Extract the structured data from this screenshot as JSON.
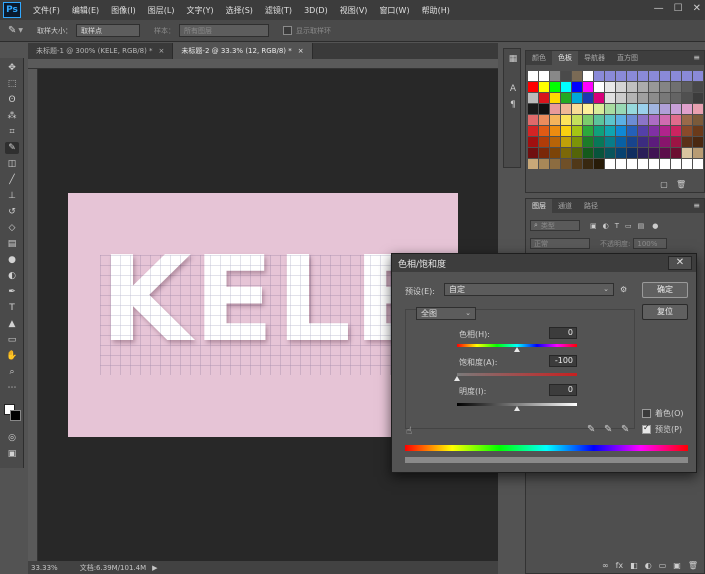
{
  "app": {
    "logo": "Ps"
  },
  "menu": [
    "文件(F)",
    "编辑(E)",
    "图像(I)",
    "图层(L)",
    "文字(Y)",
    "选择(S)",
    "滤镜(T)",
    "3D(D)",
    "视图(V)",
    "窗口(W)",
    "帮助(H)"
  ],
  "window_controls": {
    "minimize": "—",
    "maximize": "☐",
    "close": "✕"
  },
  "options_bar": {
    "sample_size_label": "取样大小：",
    "sample_size_value": "取样点",
    "sample_label": "样本：",
    "sample_value": "所有图层",
    "show_ring_label": "显示取样环"
  },
  "tabs": [
    {
      "label": "未标题-1 @ 300% (KELE, RGB/8) *",
      "close": "×"
    },
    {
      "label": "未标题-2 @ 33.3% (12, RGB/8) *",
      "close": "×"
    }
  ],
  "canvas": {
    "text": "KELE"
  },
  "status": {
    "zoom": "33.33%",
    "doc": "文档:6.39M/101.4M"
  },
  "color_panel": {
    "tabs": [
      "颜色",
      "色板",
      "导航器",
      "直方图"
    ],
    "swatches": [
      "#ffffff",
      "#ffffff",
      "#888888",
      "#4a4a4a",
      "#7a6a55",
      "#ffffff",
      "#8a8ad8",
      "#8a8ad8",
      "#8a8ad8",
      "#8a8ad8",
      "#8a8ad8",
      "#8a8ad8",
      "#8a8ad8",
      "#8a8ad8",
      "#8a8ad8",
      "#8a8ad8",
      "#ff0000",
      "#ffff00",
      "#00ff00",
      "#00ffff",
      "#0000ff",
      "#ff00ff",
      "#ffffff",
      "#e8e8e8",
      "#d4d4d4",
      "#c0c0c0",
      "#acacac",
      "#989898",
      "#848484",
      "#707070",
      "#5c5c5c",
      "#484848",
      "#bbbbbb",
      "#d8141c",
      "#ffd800",
      "#22aa22",
      "#00a8d8",
      "#1a3ab0",
      "#d8007a",
      "#e0e0e0",
      "#cccccc",
      "#b4b4b4",
      "#a0a0a0",
      "#8c8c8c",
      "#787878",
      "#646464",
      "#505050",
      "#3c3c3c",
      "#1a1a1a",
      "#111111",
      "#e89a9a",
      "#f0b896",
      "#f8dc96",
      "#fff09a",
      "#d8ec9a",
      "#a8dca0",
      "#98d8b4",
      "#96d8dc",
      "#9ad0ec",
      "#a0b4e0",
      "#b0a0d8",
      "#c8a0d8",
      "#e0a0cc",
      "#e8a0b0",
      "#e06a6a",
      "#ec8c5c",
      "#f4b45c",
      "#fce45c",
      "#c4e05c",
      "#7ccc6c",
      "#5cc49c",
      "#5cc4cc",
      "#5cb0e4",
      "#6c8cd4",
      "#8c74c8",
      "#ac6cc4",
      "#d06cb0",
      "#e06c8c",
      "#9a6a4a",
      "#7a5a3a",
      "#d42424",
      "#e05a14",
      "#ec8c10",
      "#f8d010",
      "#a4c414",
      "#2ca83c",
      "#10a07c",
      "#10a4b0",
      "#1088d4",
      "#2460b8",
      "#5440a8",
      "#8030a4",
      "#b0248c",
      "#cc2460",
      "#8a4a2a",
      "#6a3a1a",
      "#a01010",
      "#b03c08",
      "#b86408",
      "#c0a008",
      "#7c9408",
      "#1c7c28",
      "#087858",
      "#087c88",
      "#0860a4",
      "#18448c",
      "#3c2c80",
      "#5c1c7c",
      "#88146c",
      "#9c1444",
      "#5a3018",
      "#4a2810",
      "#701010",
      "#7a2808",
      "#7c4408",
      "#7c6808",
      "#546408",
      "#145a1c",
      "#08543c",
      "#08545c",
      "#084270",
      "#102e60",
      "#2a1e58",
      "#401454",
      "#5c0e4a",
      "#6c0e30",
      "#d8c4a0",
      "#b89c74",
      "#c8a878",
      "#a88858",
      "#8c6c40",
      "#705028",
      "#503818",
      "#382810",
      "#281c08",
      "#ffffff",
      "#ffffff",
      "#ffffff",
      "#ffffff",
      "#ffffff",
      "#ffffff",
      "#ffffff",
      "#ffffff",
      "#ffffff"
    ]
  },
  "layers_panel": {
    "tabs": [
      "图层",
      "通道",
      "路径"
    ],
    "kind_placeholder": "类型",
    "blend_mode": "正常",
    "opacity_label": "不透明度:",
    "opacity_value": "100%",
    "footer_icons": [
      "∞",
      "fx",
      "◧",
      "◐",
      "▭",
      "▣",
      "🗑"
    ]
  },
  "dialog": {
    "title": "色相/饱和度",
    "close": "✕",
    "preset_label": "预设(E):",
    "preset_value": "自定",
    "channel_value": "全图",
    "hue_label": "色相(H):",
    "hue_value": "0",
    "saturation_label": "饱和度(A):",
    "saturation_value": "-100",
    "lightness_label": "明度(I):",
    "lightness_value": "0",
    "ok_label": "确定",
    "reset_label": "复位",
    "colorize_label": "着色(O)",
    "colorize_checked": false,
    "preview_label": "预览(P)",
    "preview_checked": true,
    "hue_level": 0.5,
    "saturation_level": 0.0,
    "lightness_level": 0.5
  }
}
